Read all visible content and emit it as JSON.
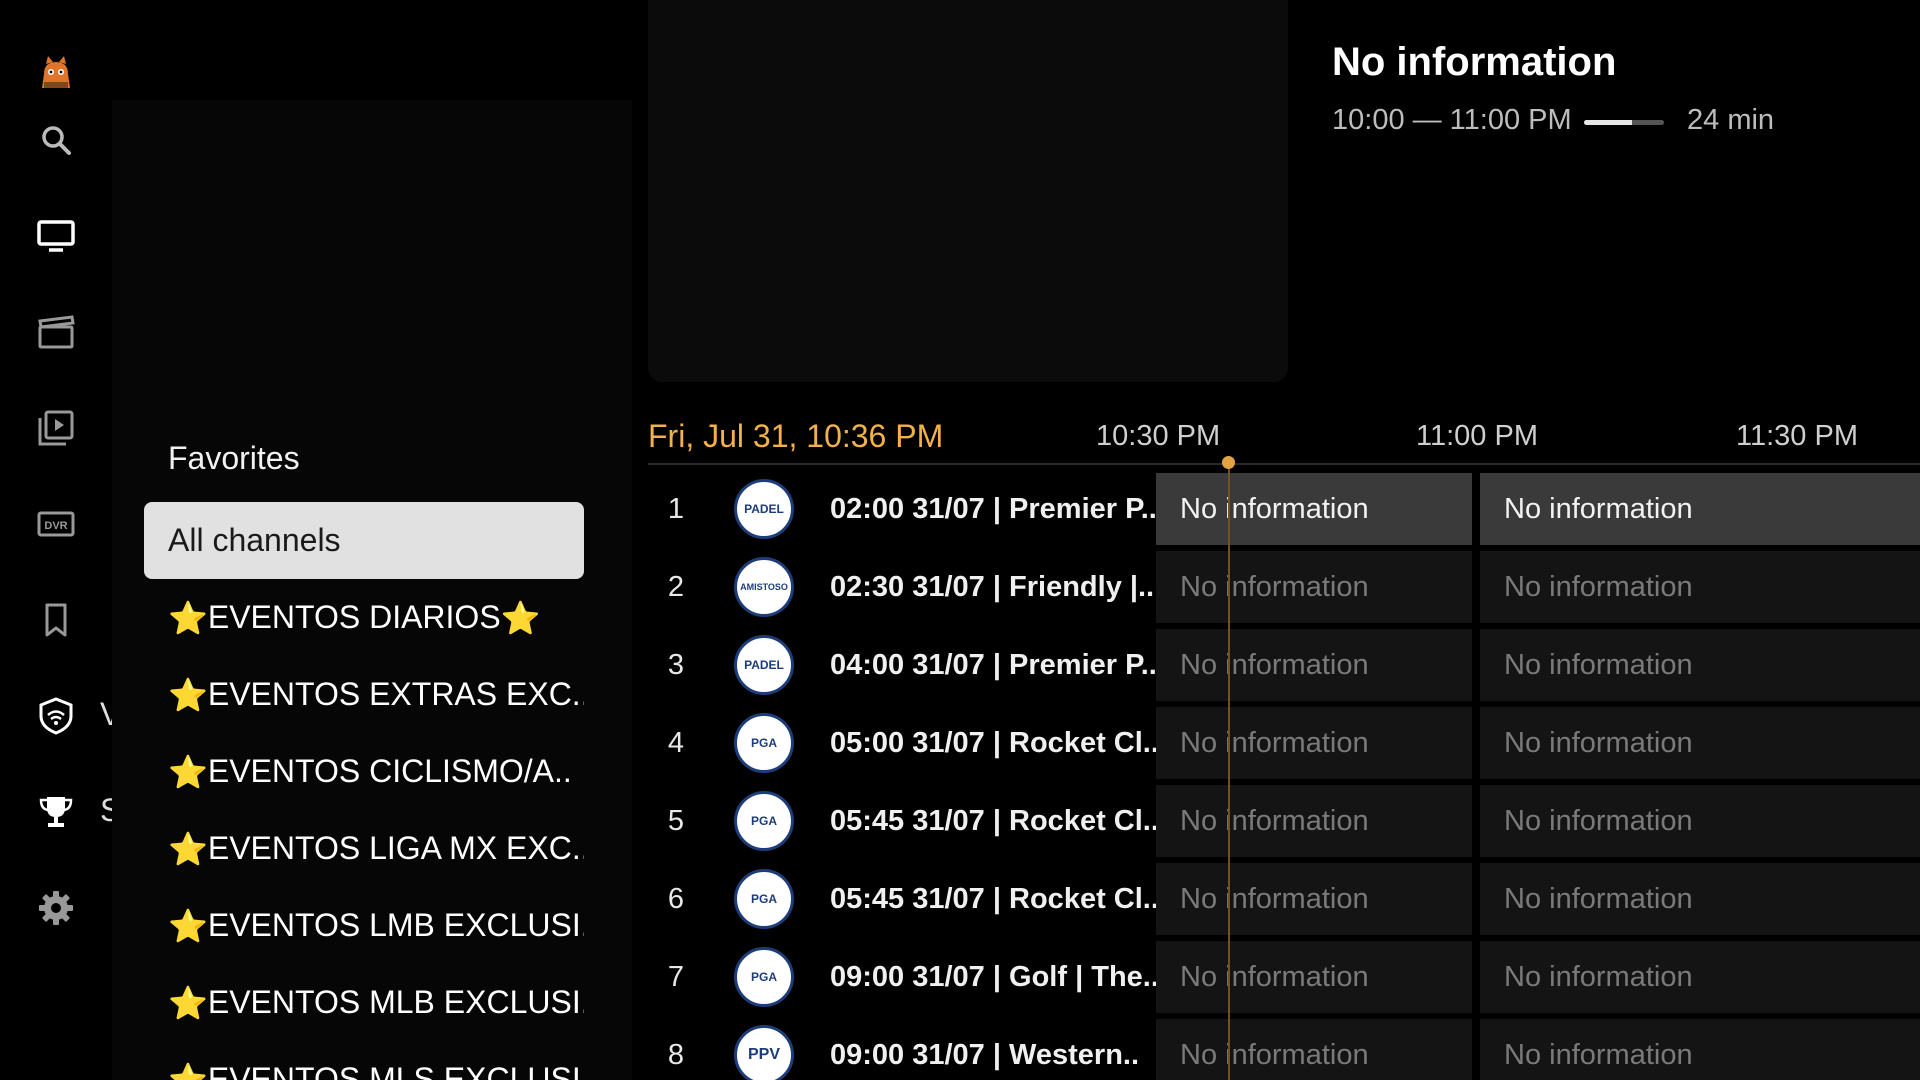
{
  "colors": {
    "accent": "#f3b14a",
    "selected_bg": "#e1e1e1",
    "star": "#f6c21a"
  },
  "rail": {
    "items": [
      {
        "icon": "avatar-icon"
      },
      {
        "icon": "search-icon"
      },
      {
        "icon": "tv-icon"
      },
      {
        "icon": "clapperboard-icon"
      },
      {
        "icon": "video-library-icon"
      },
      {
        "icon": "dvr-icon"
      },
      {
        "icon": "bookmark-icon"
      },
      {
        "icon": "vpn-shield-icon",
        "peek": "V"
      },
      {
        "icon": "trophy-icon",
        "peek": "S"
      },
      {
        "icon": "gear-icon"
      }
    ],
    "dvr_text": "DVR"
  },
  "categories": {
    "title": "Favorites",
    "items": [
      {
        "pre": "",
        "label": "All channels",
        "post": ""
      },
      {
        "pre": "⭐",
        "label": "EVENTOS DIARIOS ",
        "post": "⭐"
      },
      {
        "pre": "⭐",
        "label": "EVENTOS EXTRAS EXC..",
        "post": ""
      },
      {
        "pre": "⭐",
        "label": "EVENTOS CICLISMO/A..",
        "post": ""
      },
      {
        "pre": "⭐",
        "label": "EVENTOS LIGA MX EXC..",
        "post": ""
      },
      {
        "pre": "⭐",
        "label": "EVENTOS LMB EXCLUSI..",
        "post": ""
      },
      {
        "pre": "⭐",
        "label": "EVENTOS MLB EXCLUSI..",
        "post": ""
      },
      {
        "pre": "⭐",
        "label": "EVENTOS MLS EXCLUSI..",
        "post": ""
      }
    ]
  },
  "program": {
    "title": "No information",
    "time": "10:00 — 11:00 PM",
    "progress": 0.6,
    "duration": "24 min"
  },
  "guide": {
    "date": "Fri, Jul 31, 10:36 PM",
    "slots": [
      "10:30 PM",
      "11:00 PM",
      "11:30 PM"
    ],
    "rows": [
      {
        "num": "1",
        "logo": "PADEL",
        "name": "02:00 31/07 | Premier P..",
        "c1": "No information",
        "c2": "No information"
      },
      {
        "num": "2",
        "logo": "AMISTOSO",
        "name": "02:30 31/07 | Friendly |..",
        "c1": "No information",
        "c2": "No information"
      },
      {
        "num": "3",
        "logo": "PADEL",
        "name": "04:00 31/07 | Premier P..",
        "c1": "No information",
        "c2": "No information"
      },
      {
        "num": "4",
        "logo": "PGA",
        "name": "05:00 31/07 | Rocket Cl..",
        "c1": "No information",
        "c2": "No information"
      },
      {
        "num": "5",
        "logo": "PGA",
        "name": "05:45 31/07 | Rocket Cl..",
        "c1": "No information",
        "c2": "No information"
      },
      {
        "num": "6",
        "logo": "PGA",
        "name": "05:45 31/07 | Rocket Cl..",
        "c1": "No information",
        "c2": "No information"
      },
      {
        "num": "7",
        "logo": "PGA",
        "name": "09:00 31/07 | Golf | The..",
        "c1": "No information",
        "c2": "No information"
      },
      {
        "num": "8",
        "logo": "PPV",
        "name": "09:00 31/07 | Western..",
        "c1": "No information",
        "c2": "No information"
      }
    ]
  }
}
